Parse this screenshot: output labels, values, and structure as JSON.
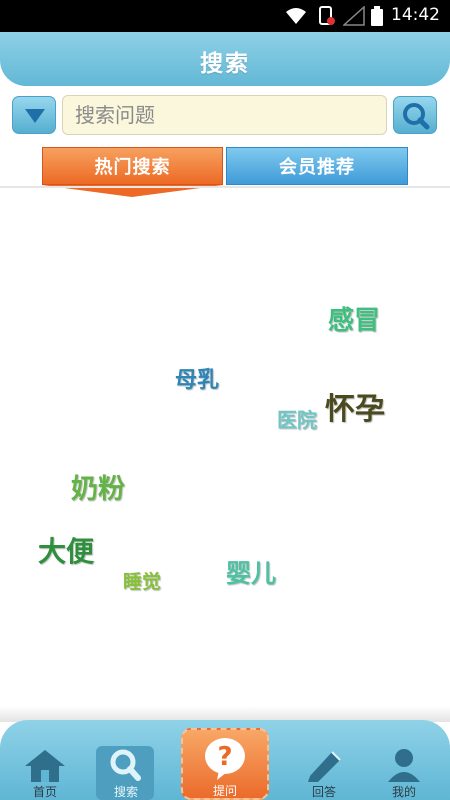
{
  "status_bar": {
    "time": "14:42"
  },
  "header": {
    "title": "搜索"
  },
  "search": {
    "placeholder": "搜索问题"
  },
  "tabs": [
    {
      "label": "热门搜索",
      "active": true
    },
    {
      "label": "会员推荐",
      "active": false
    }
  ],
  "hot_keywords": [
    {
      "text": "感冒",
      "color": "#3fbf7f"
    },
    {
      "text": "母乳",
      "color": "#2f86b6"
    },
    {
      "text": "医院",
      "color": "#6fc6c4"
    },
    {
      "text": "怀孕",
      "color": "#4a4a1e"
    },
    {
      "text": "奶粉",
      "color": "#64b346"
    },
    {
      "text": "大便",
      "color": "#2e8f3c"
    },
    {
      "text": "睡觉",
      "color": "#87c13c"
    },
    {
      "text": "婴儿",
      "color": "#4ec1a3"
    }
  ],
  "bottom_nav": [
    {
      "label": "首页",
      "icon": "home-icon"
    },
    {
      "label": "搜索",
      "icon": "search-icon",
      "active": true
    },
    {
      "label": "提问",
      "icon": "question-icon"
    },
    {
      "label": "回答",
      "icon": "pencil-icon"
    },
    {
      "label": "我的",
      "icon": "user-icon"
    }
  ],
  "colors": {
    "accent_blue": "#62b8d6",
    "accent_orange": "#ec6a25",
    "member_tab_blue": "#3f9bd8"
  }
}
